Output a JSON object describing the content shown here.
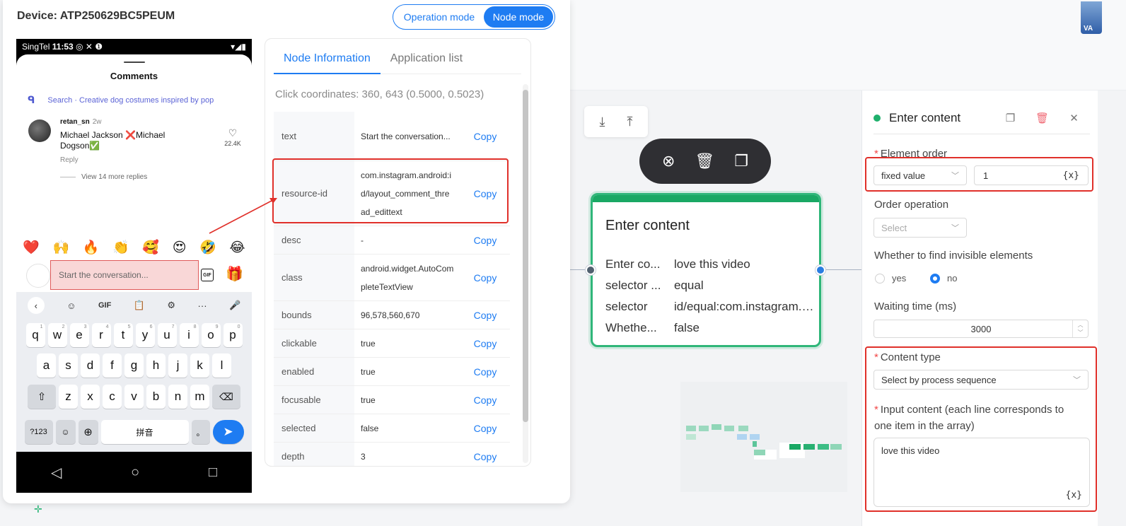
{
  "device": {
    "title": "Device: ATP250629BC5PEUM",
    "modes": [
      "Operation mode",
      "Node mode"
    ],
    "active_mode": "Node mode"
  },
  "phone": {
    "status": {
      "carrier": "SingTel",
      "time": "11:53",
      "icons": "◎ ✕ ❶"
    },
    "comments_title": "Comments",
    "search_text": "Search · Creative dog costumes inspired by pop",
    "comment": {
      "user": "retan_sn",
      "age": "2w",
      "text": "Michael Jackson ❌Michael Dogson✅",
      "reply": "Reply",
      "likes": "22.4K"
    },
    "view_more": "View 14 more replies",
    "emojis": [
      "❤️",
      "🙌",
      "🔥",
      "👏",
      "🥰",
      "😍",
      "🤣",
      "😂"
    ],
    "input_placeholder": "Start the conversation...",
    "gif_label": "GIF",
    "keyboard": {
      "top": [
        "‹",
        "☺",
        "GIF",
        "📋",
        "⚙",
        "···",
        "🎤"
      ],
      "row1": [
        "q",
        "w",
        "e",
        "r",
        "t",
        "y",
        "u",
        "i",
        "o",
        "p"
      ],
      "row1_nums": [
        "1",
        "2",
        "3",
        "4",
        "5",
        "6",
        "7",
        "8",
        "9",
        "0"
      ],
      "row2": [
        "a",
        "s",
        "d",
        "f",
        "g",
        "h",
        "j",
        "k",
        "l"
      ],
      "row3": [
        "z",
        "x",
        "c",
        "v",
        "b",
        "n",
        "m"
      ],
      "row4": {
        "sym": "?123",
        "mic": "☺",
        "globe": "⊕",
        "space": "拼音",
        "period": "。",
        "enter": "➤"
      }
    },
    "nav": [
      "◁",
      "○",
      "□"
    ]
  },
  "node_panel": {
    "tabs": [
      "Node Information",
      "Application list"
    ],
    "active_tab": "Node Information",
    "click_coordinates": "Click coordinates: 360, 643 (0.5000, 0.5023)",
    "copy_label": "Copy",
    "rows": [
      {
        "key": "text",
        "value": "Start the conversation..."
      },
      {
        "key": "resource-id",
        "value": "com.instagram.android:id/layout_comment_thread_edittext"
      },
      {
        "key": "desc",
        "value": "-"
      },
      {
        "key": "class",
        "value": "android.widget.AutoCompleteTextView"
      },
      {
        "key": "bounds",
        "value": "96,578,560,670"
      },
      {
        "key": "clickable",
        "value": "true"
      },
      {
        "key": "enabled",
        "value": "true"
      },
      {
        "key": "focusable",
        "value": "true"
      },
      {
        "key": "selected",
        "value": "false"
      },
      {
        "key": "depth",
        "value": "3"
      }
    ]
  },
  "canvas": {
    "corner_label": "VA",
    "node": {
      "title": "Enter content",
      "rows": [
        {
          "key": "Enter co...",
          "value": "love this video"
        },
        {
          "key": "selector ...",
          "value": "equal"
        },
        {
          "key": "selector",
          "value": "id/equal:com.instagram.android:id/layout_comment_thread_edittext"
        },
        {
          "key": "Whethe...",
          "value": "false"
        }
      ]
    }
  },
  "settings": {
    "title": "Enter content",
    "element_order": {
      "label": "Element order",
      "mode": "fixed value",
      "value": "1",
      "fx": "{x}"
    },
    "order_operation": {
      "label": "Order operation",
      "placeholder": "Select"
    },
    "invisible": {
      "label": "Whether to find invisible elements",
      "yes": "yes",
      "no": "no",
      "selected": "no"
    },
    "waiting": {
      "label": "Waiting time (ms)",
      "value": "3000"
    },
    "content_type": {
      "label": "Content type",
      "value": "Select by process sequence"
    },
    "input_content": {
      "label": "Input content (each line corresponds to one item in the array)",
      "value": "love this video",
      "fx": "{x}"
    }
  },
  "colors": {
    "accent": "#1e7cf2",
    "node_green": "#19a864",
    "highlight_red": "#e0302a"
  }
}
